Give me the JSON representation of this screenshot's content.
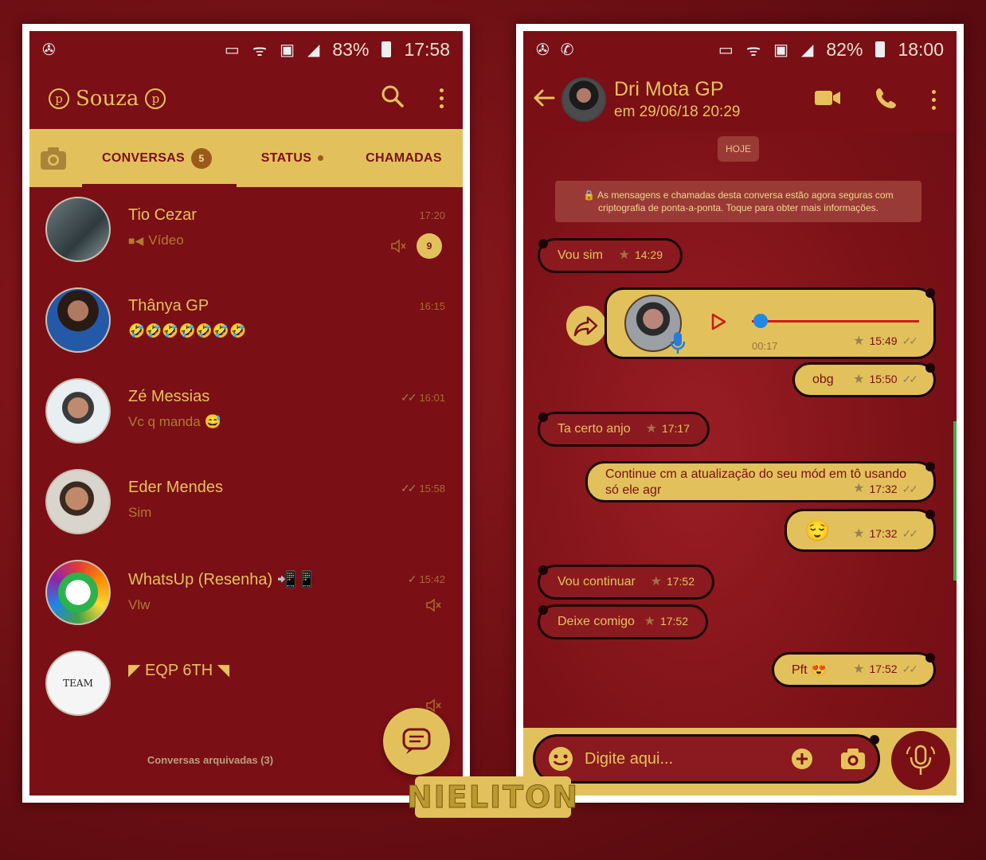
{
  "left": {
    "status": {
      "battery": "83%",
      "time": "17:58"
    },
    "brand": {
      "p_left": "p",
      "name": "Souza",
      "p_right": "p"
    },
    "tabs": {
      "chats": "CONVERSAS",
      "chats_badge": "5",
      "status": "STATUS",
      "calls": "CHAMADAS"
    },
    "chats": [
      {
        "name": "Tio Cezar",
        "message": "Vídeo",
        "time": "17:20",
        "unread": "9",
        "muted": true
      },
      {
        "name": "Thânya GP",
        "message": "🤣🤣🤣🤣🤣🤣🤣",
        "time": "16:15"
      },
      {
        "name": "Zé Messias",
        "message": "Vc q manda 😅",
        "time": "16:01"
      },
      {
        "name": "Eder Mendes",
        "message": "Sim",
        "time": "15:58"
      },
      {
        "name": "WhatsUp (Resenha) 📲📱",
        "message": "Vlw",
        "time": "15:42",
        "muted": true
      },
      {
        "name": "◤ EQP 6TH ◥",
        "message": "",
        "time": "",
        "muted": true,
        "avatar_text": "TEAM"
      }
    ],
    "archived": "Conversas arquivadas (3)"
  },
  "right": {
    "status": {
      "battery": "82%",
      "time": "18:00"
    },
    "contact": {
      "name": "Dri Mota GP",
      "last_seen": "em 29/06/18 20:29"
    },
    "day_chip": "HOJE",
    "encryption_notice": "🔒 As mensagens e chamadas desta conversa estão agora seguras com criptografia de ponta-a-ponta. Toque para obter mais informações.",
    "messages": [
      {
        "dir": "in",
        "text": "Vou sim",
        "time": "14:29"
      },
      {
        "dir": "out",
        "type": "voice",
        "duration": "00:17",
        "time": "15:49"
      },
      {
        "dir": "out",
        "text": "obg",
        "time": "15:50"
      },
      {
        "dir": "in",
        "text": "Ta certo anjo",
        "time": "17:17"
      },
      {
        "dir": "out",
        "text": "Continue cm a atualização do seu mód em tô usando só ele agr",
        "time": "17:32"
      },
      {
        "dir": "out",
        "text": "😌",
        "time": "17:32"
      },
      {
        "dir": "in",
        "text": "Vou continuar",
        "time": "17:52"
      },
      {
        "dir": "in",
        "text": "Deixe comigo",
        "time": "17:52"
      },
      {
        "dir": "out",
        "text": "Pft 😍",
        "time": "17:52"
      }
    ],
    "input_placeholder": "Digite aqui..."
  },
  "watermark": "NIELITON",
  "colors": {
    "accent": "#e2c15c",
    "background": "#7a0f16",
    "text_gold": "#e6c25a"
  }
}
